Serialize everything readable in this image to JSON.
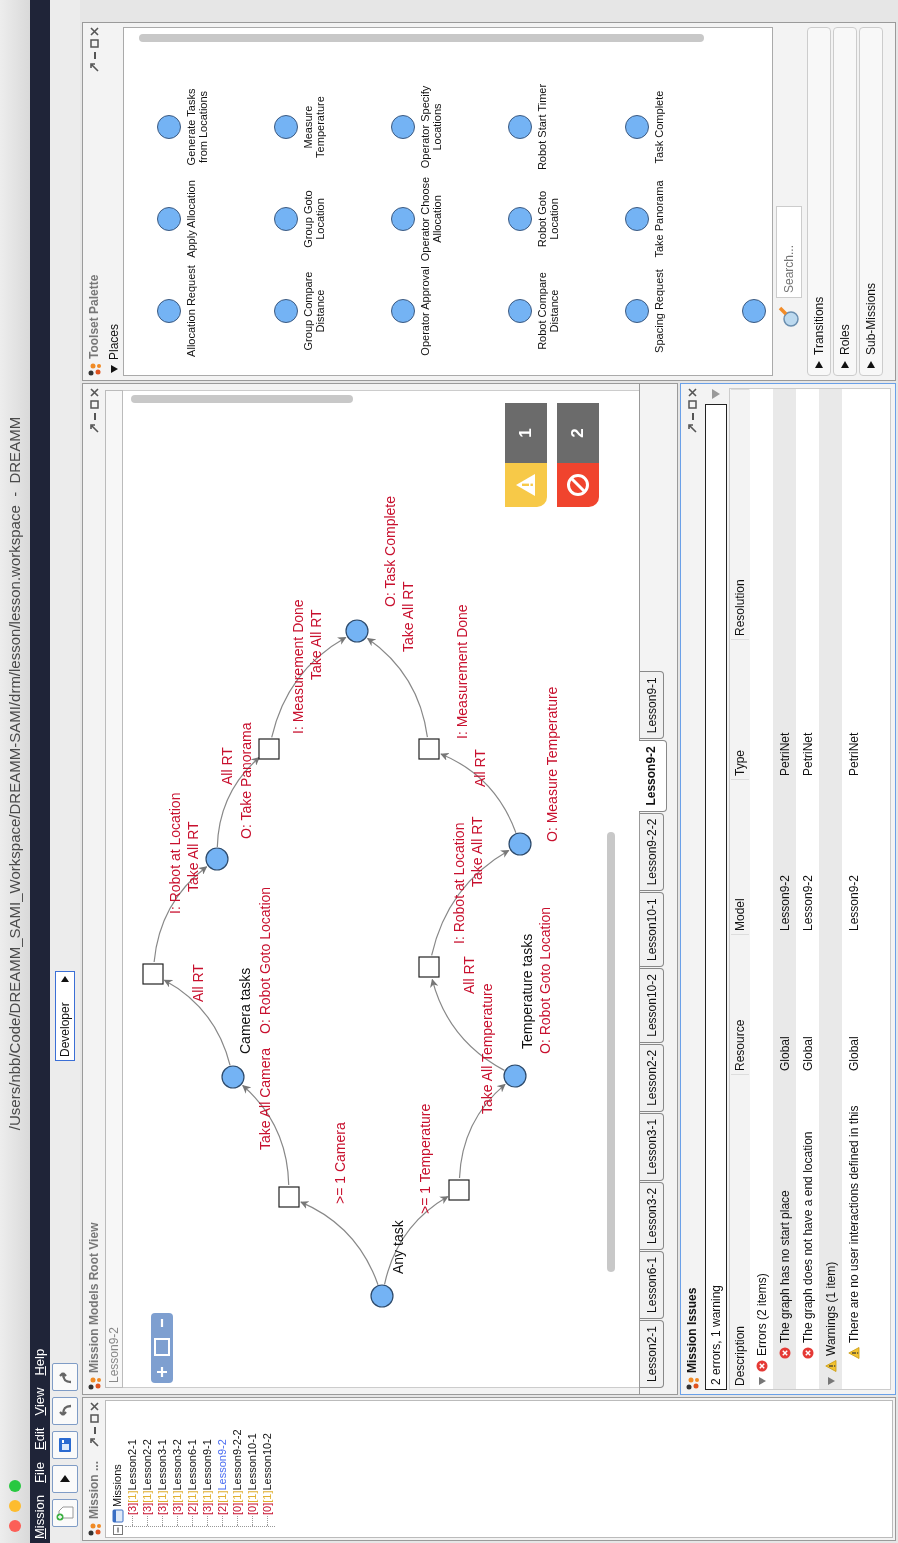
{
  "window": {
    "title": "/Users/nbb/Code/DREAMM_SAMI_Workspace/DREAMM-SAMI/drm/lesson/lesson.workspace  -  DREAMM",
    "menu": [
      "Mission",
      "File",
      "Edit",
      "View",
      "Help"
    ]
  },
  "toolbar": {
    "perspective": "Developer"
  },
  "missions_panel": {
    "title": "Mission ...",
    "root": "Missions",
    "items": [
      {
        "errors": "[3]",
        "warnings": "[1]",
        "label": "Lesson2-1",
        "selected": false
      },
      {
        "errors": "[3]",
        "warnings": "[1]",
        "label": "Lesson2-2",
        "selected": false
      },
      {
        "errors": "[3]",
        "warnings": "[1]",
        "label": "Lesson3-1",
        "selected": false
      },
      {
        "errors": "[3]",
        "warnings": "[1]",
        "label": "Lesson3-2",
        "selected": false
      },
      {
        "errors": "[2]",
        "warnings": "[1]",
        "label": "Lesson6-1",
        "selected": false
      },
      {
        "errors": "[3]",
        "warnings": "[1]",
        "label": "Lesson9-1",
        "selected": false
      },
      {
        "errors": "[2]",
        "warnings": "[1]",
        "label": "Lesson9-2",
        "selected": true
      },
      {
        "errors": "[0]",
        "warnings": "[1]",
        "label": "Lesson9-2-2",
        "selected": false
      },
      {
        "errors": "[0]",
        "warnings": "[1]",
        "label": "Lesson10-1",
        "selected": false
      },
      {
        "errors": "[0]",
        "warnings": "[1]",
        "label": "Lesson10-2",
        "selected": false
      }
    ]
  },
  "models_view": {
    "title": "Mission Models Root View",
    "breadcrumb": "Lesson9-2",
    "nodes": [
      {
        "kind": "place",
        "labels": [
          {
            "kind": "name",
            "text": "Any task"
          }
        ]
      },
      {
        "kind": "transition",
        "labels": [
          {
            "kind": "inscription",
            "text": ">= 1 Camera"
          }
        ]
      },
      {
        "kind": "transition",
        "labels": [
          {
            "kind": "inscription",
            "text": ">= 1 Temperature"
          }
        ]
      },
      {
        "kind": "place",
        "labels": [
          {
            "kind": "name",
            "text": "Camera tasks"
          },
          {
            "kind": "inscription",
            "text": "Take All Camera"
          },
          {
            "kind": "inscription",
            "text": "O: Robot Goto Location"
          }
        ]
      },
      {
        "kind": "transition",
        "labels": [
          {
            "kind": "inscription",
            "text": "All RT"
          }
        ]
      },
      {
        "kind": "place",
        "labels": [
          {
            "kind": "inscription",
            "text": "I: Robot at Location"
          },
          {
            "kind": "inscription",
            "text": "Take All RT"
          }
        ]
      },
      {
        "kind": "transition",
        "labels": [
          {
            "kind": "inscription",
            "text": "All RT"
          },
          {
            "kind": "inscription",
            "text": "O: Take Panorama"
          }
        ]
      },
      {
        "kind": "place",
        "labels": [
          {
            "kind": "inscription",
            "text": "I: Measurement Done"
          },
          {
            "kind": "inscription",
            "text": "Take All RT"
          },
          {
            "kind": "inscription",
            "text": "O: Task Complete"
          },
          {
            "kind": "inscription",
            "text": "Take All RT"
          }
        ]
      },
      {
        "kind": "place",
        "labels": [
          {
            "kind": "name",
            "text": "Temperature tasks"
          },
          {
            "kind": "inscription",
            "text": "Take All Temperature"
          },
          {
            "kind": "inscription",
            "text": "All RT"
          },
          {
            "kind": "inscription",
            "text": "O: Robot Goto Location"
          }
        ]
      },
      {
        "kind": "transition",
        "labels": [
          {
            "kind": "inscription",
            "text": "I: Robot at Location"
          },
          {
            "kind": "inscription",
            "text": "Take All RT"
          }
        ]
      },
      {
        "kind": "place",
        "labels": [
          {
            "kind": "inscription",
            "text": "O: Measure Temperature"
          }
        ]
      },
      {
        "kind": "transition",
        "labels": [
          {
            "kind": "inscription",
            "text": "All RT"
          },
          {
            "kind": "inscription",
            "text": "I: Measurement Done"
          }
        ]
      }
    ],
    "badges": [
      {
        "kind": "warning",
        "count": "1"
      },
      {
        "kind": "error",
        "count": "2"
      }
    ],
    "tabs": [
      {
        "label": "Lesson2-1",
        "selected": false
      },
      {
        "label": "Lesson6-1",
        "selected": false
      },
      {
        "label": "Lesson3-2",
        "selected": false
      },
      {
        "label": "Lesson3-1",
        "selected": false
      },
      {
        "label": "Lesson2-2",
        "selected": false
      },
      {
        "label": "Lesson10-2",
        "selected": false
      },
      {
        "label": "Lesson10-1",
        "selected": false
      },
      {
        "label": "Lesson9-2-2",
        "selected": false
      },
      {
        "label": "Lesson9-2",
        "selected": true
      },
      {
        "label": "Lesson9-1",
        "selected": false
      }
    ]
  },
  "issues": {
    "title": "Mission Issues",
    "filter": "2 errors, 1 warning",
    "columns": [
      "Description",
      "Resource",
      "Model",
      "Type",
      "Resolution"
    ],
    "groups": [
      {
        "kind": "error",
        "text": "Errors (2 items)",
        "expanded": true,
        "children": [
          {
            "kind": "error",
            "cells": [
              "The graph has no start place",
              "Global",
              "Lesson9-2",
              "PetriNet"
            ]
          },
          {
            "kind": "error",
            "cells": [
              "The graph does not have a end location",
              "Global",
              "Lesson9-2",
              "PetriNet"
            ]
          }
        ]
      },
      {
        "kind": "warning",
        "text": "Warnings (1 item)",
        "expanded": true,
        "children": [
          {
            "kind": "warning",
            "cells": [
              "There are no user interactions defined in this",
              "Global",
              "Lesson9-2",
              "PetriNet"
            ]
          }
        ]
      }
    ]
  },
  "palette": {
    "title": "Toolset Palette",
    "section": {
      "label": "Places",
      "expanded": true
    },
    "items": [
      {
        "kind": "place",
        "label": "Allocation Request"
      },
      {
        "kind": "place",
        "label": "Apply Allocation"
      },
      {
        "kind": "place",
        "label": "Generate Tasks from Locations"
      },
      {
        "kind": "place",
        "label": "Group Compare Distance"
      },
      {
        "kind": "place",
        "label": "Group Goto Location"
      },
      {
        "kind": "place",
        "label": "Measure Temperature"
      },
      {
        "kind": "place",
        "label": "Operator Approval"
      },
      {
        "kind": "place",
        "label": "Operator Choose Allocation"
      },
      {
        "kind": "place",
        "label": "Operator Specify Locations"
      },
      {
        "kind": "place",
        "label": "Robot Compare Distance"
      },
      {
        "kind": "place",
        "label": "Robot Goto Location"
      },
      {
        "kind": "place",
        "label": "Robot Start Timer"
      },
      {
        "kind": "place",
        "label": "Spacing Request"
      },
      {
        "kind": "place",
        "label": "Take Panorama"
      },
      {
        "kind": "place",
        "label": "Task Complete"
      },
      {
        "kind": "place"
      }
    ],
    "search": {
      "placeholder": "Search..."
    },
    "sections": [
      {
        "label": "Transitions",
        "expanded": false
      },
      {
        "label": "Roles",
        "expanded": false
      },
      {
        "label": "Sub-Missions",
        "expanded": false
      }
    ]
  }
}
